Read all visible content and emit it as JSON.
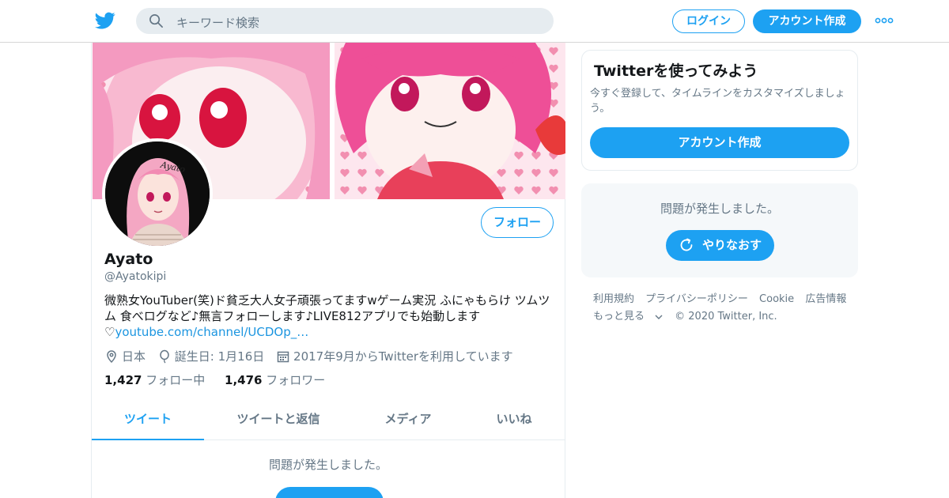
{
  "header": {
    "search_placeholder": "キーワード検索",
    "login_label": "ログイン",
    "signup_label": "アカウント作成"
  },
  "profile": {
    "name": "Ayato",
    "handle": "@Ayatokipi",
    "avatar_text": "Ayato",
    "follow_label": "フォロー",
    "bio_line1": "微熟女YouTuber(笑)ド貧乏大人女子頑張ってますwゲーム実況 ふにゃもらけ ツムツ",
    "bio_line2": "ム 食べログなど♪無言フォローします♪LIVE812アプリでも始動します",
    "bio_heart": "♡",
    "bio_link": "youtube.com/channel/UCDOp_…",
    "location": "日本",
    "birthday": "誕生日: 1月16日",
    "joined": "2017年9月からTwitterを利用しています",
    "following_count": "1,427",
    "following_label": "フォロー中",
    "followers_count": "1,476",
    "followers_label": "フォロワー"
  },
  "tabs": [
    "ツイート",
    "ツイートと返信",
    "メディア",
    "いいね"
  ],
  "timeline": {
    "error_text": "問題が発生しました。"
  },
  "sidebar": {
    "signup_card": {
      "title": "Twitterを使ってみよう",
      "text": "今すぐ登録して、タイムラインをカスタマイズしましょう。",
      "button": "アカウント作成"
    },
    "error_card": {
      "text": "問題が発生しました。",
      "retry": "やりなおす"
    },
    "footer": {
      "terms": "利用規約",
      "privacy": "プライバシーポリシー",
      "cookie": "Cookie",
      "ads": "広告情報",
      "more": "もっと見る",
      "copyright": "© 2020 Twitter, Inc."
    }
  },
  "colors": {
    "accent": "#1da1f2",
    "muted": "#657786",
    "text": "#14171a",
    "border": "#e6ecf0"
  }
}
